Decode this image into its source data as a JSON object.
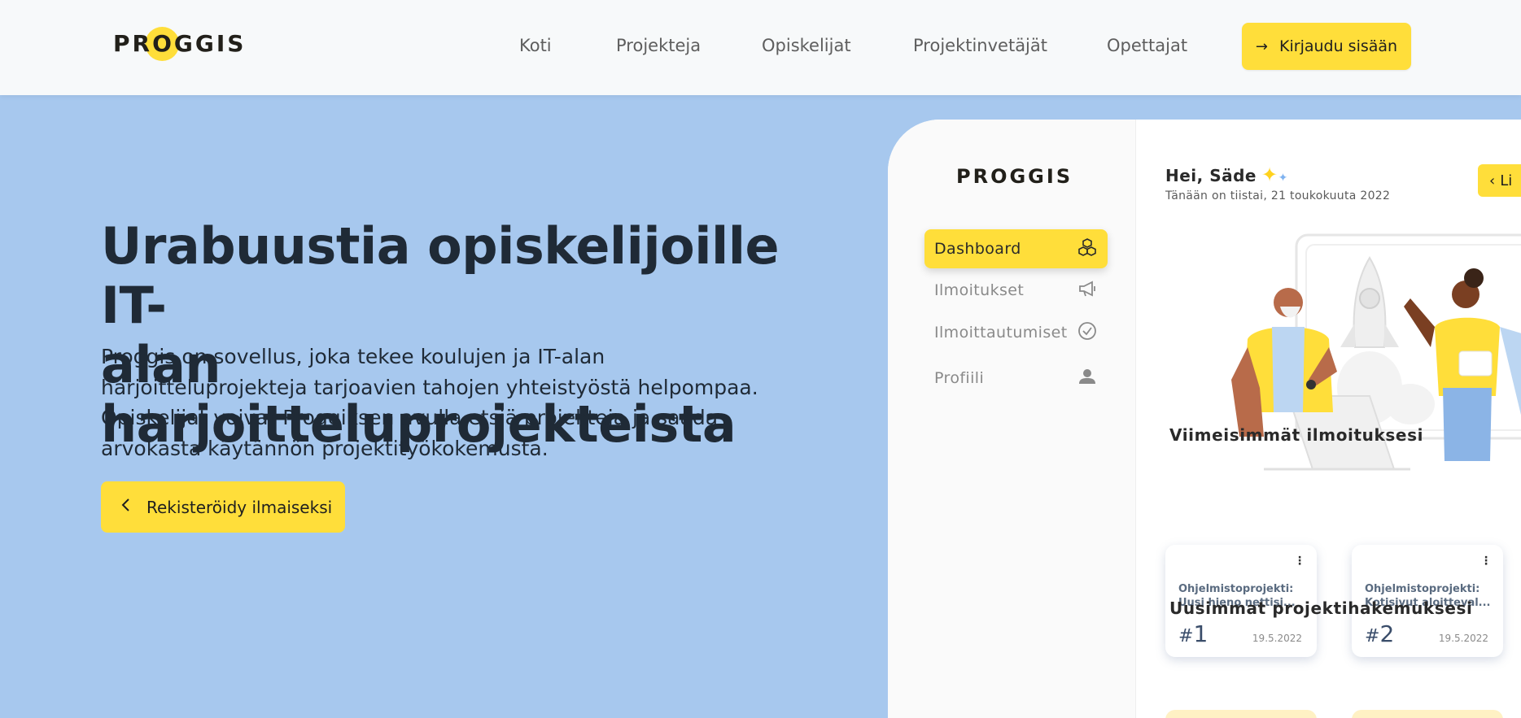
{
  "header": {
    "logo": {
      "pre": "PR",
      "o": "O",
      "post": "GGIS"
    },
    "nav": [
      "Koti",
      "Projekteja",
      "Opiskelijat",
      "Projektinvetäjät",
      "Opettajat"
    ],
    "login_label": "Kirjaudu sisään"
  },
  "hero": {
    "title_line1": "Urabuustia opiskelijoille IT-",
    "title_line2": "alan harjoitteluprojekteista",
    "text": "Proggis on sovellus, joka tekee koulujen ja IT-alan harjoitteluprojekteja tarjoavien tahojen yhteistyöstä helpompaa. Opiskelijat voivat Proggiksen avulla etsiä projekteja ja saada arvokasta käytännön projektityökokemusta.",
    "register_label": "Rekisteröidy ilmaiseksi"
  },
  "mockup": {
    "logo": {
      "pre": "PR",
      "o": "O",
      "post": "GGIS"
    },
    "menu": [
      {
        "label": "Dashboard",
        "icon": "cubes-icon"
      },
      {
        "label": "Ilmoitukset",
        "icon": "megaphone-icon"
      },
      {
        "label": "Ilmoittautumiset",
        "icon": "check-circle-icon"
      },
      {
        "label": "Profiili",
        "icon": "user-icon"
      }
    ],
    "greeting": "Hei, Säde",
    "date_text": "Tänään on tiistai, 21 toukokuuta 2022",
    "top_button_label": "Li",
    "latest_heading": "Viimeisimmät ilmoituksesi",
    "cards": [
      {
        "title": "Ohjelmistoprojekti: Uusi hieno nettisi...",
        "hash": "#",
        "number": "1",
        "date": "19.5.2022"
      },
      {
        "title": "Ohjelmistoprojekti: Kotisivut aloitteval...",
        "hash": "#",
        "number": "2",
        "date": "19.5.2022"
      }
    ],
    "applications_heading": "Uusimmat projektihakemuksesi"
  },
  "colors": {
    "accent": "#ffde3a",
    "hero_bg": "#a7c8ee",
    "header_bg": "#f7f9fa",
    "text_dark": "#1f2a36"
  }
}
